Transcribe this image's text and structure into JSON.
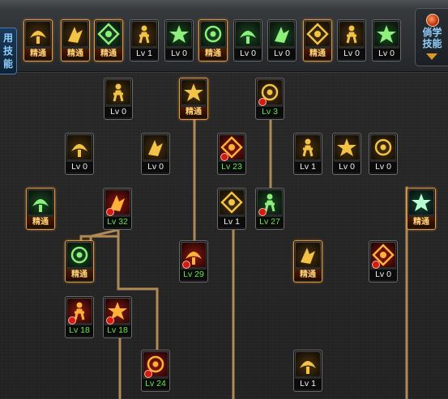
{
  "left_tab": {
    "label_line1": "用",
    "label_line2": "技能"
  },
  "right_tab": {
    "label_line1": "倘学",
    "label_line2": "技能"
  },
  "top_skills": [
    {
      "id": "t1",
      "level": "精通",
      "icon": "sit-figure-icon",
      "tone": "gold",
      "master": true
    },
    {
      "id": "t2",
      "level": "精通",
      "icon": "crouch-figure-icon",
      "tone": "gold",
      "master": true
    },
    {
      "id": "t3",
      "level": "精通",
      "icon": "kick-figure-icon",
      "tone": "green",
      "master": true
    },
    {
      "id": "t4",
      "level": "Lv 1",
      "icon": "wings-icon",
      "tone": "gold",
      "master": false
    },
    {
      "id": "t5",
      "level": "Lv 0",
      "icon": "target-icon",
      "tone": "green",
      "master": false
    },
    {
      "id": "t6",
      "level": "精通",
      "icon": "target-gear-icon",
      "tone": "green",
      "master": true
    },
    {
      "id": "t7",
      "level": "Lv 0",
      "icon": "dash-figure-icon",
      "tone": "green",
      "master": false
    },
    {
      "id": "t8",
      "level": "Lv 0",
      "icon": "double-figure-icon",
      "tone": "green",
      "master": false
    },
    {
      "id": "t9",
      "level": "精通",
      "icon": "eye-orb-icon",
      "tone": "gold",
      "master": true
    },
    {
      "id": "t10",
      "level": "Lv 0",
      "icon": "muscle-figure-icon",
      "tone": "gold",
      "master": false
    },
    {
      "id": "t11",
      "level": "Lv 0",
      "icon": "walk-figure-icon",
      "tone": "green",
      "master": false
    }
  ],
  "tree_skills": [
    {
      "id": "s1",
      "level": "Lv 0",
      "icon": "claw-icon",
      "tone": "gold",
      "master": false,
      "warn": false
    },
    {
      "id": "s2",
      "level": "精通",
      "icon": "crowd-icon",
      "tone": "gold",
      "master": true,
      "warn": false
    },
    {
      "id": "s3",
      "level": "Lv 3",
      "icon": "burst-down-icon",
      "tone": "gold",
      "master": false,
      "warn": true
    },
    {
      "id": "s4",
      "level": "Lv 0",
      "icon": "spark-burst-icon",
      "tone": "gold",
      "master": false,
      "warn": false
    },
    {
      "id": "s5",
      "level": "Lv 0",
      "icon": "crescent-slash-icon",
      "tone": "gold",
      "master": false,
      "warn": false
    },
    {
      "id": "s6",
      "level": "Lv 23",
      "icon": "armor-body-icon",
      "tone": "red",
      "master": false,
      "warn": true
    },
    {
      "id": "s7",
      "level": "Lv 1",
      "icon": "flame-wings-icon",
      "tone": "gold",
      "master": false,
      "warn": false
    },
    {
      "id": "s8",
      "level": "Lv 0",
      "icon": "kneel-icon",
      "tone": "gold",
      "master": false,
      "warn": false
    },
    {
      "id": "s9",
      "level": "Lv 0",
      "icon": "leap-strike-icon",
      "tone": "gold",
      "master": false,
      "warn": false
    },
    {
      "id": "s10",
      "level": "精通",
      "icon": "body-aura-icon",
      "tone": "green",
      "master": true,
      "warn": false
    },
    {
      "id": "s11",
      "level": "Lv 32",
      "icon": "fireball-icon",
      "tone": "red",
      "master": false,
      "warn": true
    },
    {
      "id": "s12",
      "level": "Lv 1",
      "icon": "light-pillar-icon",
      "tone": "gold",
      "master": false,
      "warn": false
    },
    {
      "id": "s13",
      "level": "Lv 27",
      "icon": "green-burst-icon",
      "tone": "green",
      "master": false,
      "warn": true
    },
    {
      "id": "s14",
      "level": "精通",
      "icon": "star-glow-icon",
      "tone": "teal",
      "master": true,
      "warn": false
    },
    {
      "id": "s15",
      "level": "精通",
      "icon": "arrow-dash-icon",
      "tone": "green",
      "master": true,
      "warn": false
    },
    {
      "id": "s16",
      "level": "Lv 29",
      "icon": "tower-flame-icon",
      "tone": "red",
      "master": false,
      "warn": true
    },
    {
      "id": "s17",
      "level": "精通",
      "icon": "shield-icon",
      "tone": "gold",
      "master": true,
      "warn": false
    },
    {
      "id": "s18",
      "level": "Lv 0",
      "icon": "spin-figure-icon",
      "tone": "red",
      "master": false,
      "warn": true
    },
    {
      "id": "s19",
      "level": "Lv 18",
      "icon": "bars-icon",
      "tone": "red",
      "master": false,
      "warn": true
    },
    {
      "id": "s20",
      "level": "Lv 18",
      "icon": "bell-icon",
      "tone": "red",
      "master": false,
      "warn": true
    },
    {
      "id": "s21",
      "level": "Lv 24",
      "icon": "charge-figure-icon",
      "tone": "red",
      "master": false,
      "warn": true
    },
    {
      "id": "s22",
      "level": "Lv 1",
      "icon": "slide-figure-icon",
      "tone": "gold",
      "master": false,
      "warn": false
    }
  ]
}
